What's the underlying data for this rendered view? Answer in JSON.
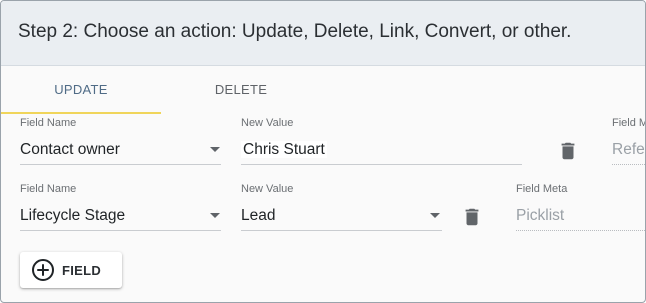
{
  "step_title": "Step 2: Choose an action: Update, Delete, Link, Convert, or other.",
  "tabs": [
    {
      "label": "UPDATE",
      "active": true
    },
    {
      "label": "DELETE",
      "active": false
    }
  ],
  "rows": [
    {
      "field_label": "Field Name",
      "field_value": "Contact owner",
      "value_label": "New Value",
      "value_value": "Chris Stuart",
      "meta_label": "Field M",
      "meta_value": "Refe"
    },
    {
      "field_label": "Field Name",
      "field_value": "Lifecycle Stage",
      "value_label": "New Value",
      "value_value": "Lead",
      "meta_label": "Field Meta",
      "meta_value": "Picklist"
    }
  ],
  "add_button": {
    "label": "FIELD",
    "icon": "plus-circle-icon"
  },
  "colors": {
    "header_bg": "#eaeef2",
    "active_tab_underline": "#f0d55a",
    "active_tab_text": "#4f6b86"
  }
}
